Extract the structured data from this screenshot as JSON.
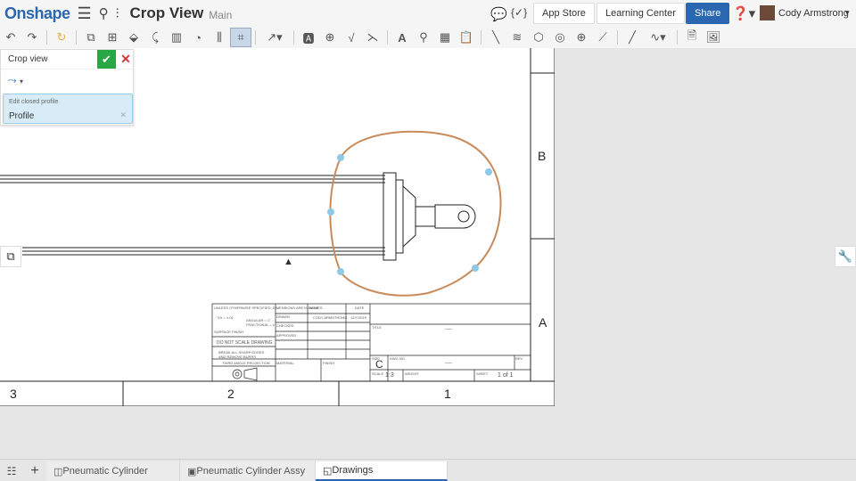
{
  "header": {
    "logo": "Onshape",
    "title": "Crop View",
    "workspace": "Main",
    "app_store": "App Store",
    "learning_center": "Learning Center",
    "share": "Share",
    "user": "Cody Armstrong"
  },
  "toolbar": {
    "icons": [
      "undo-icon",
      "redo-icon",
      "regen-icon",
      "insert-view-icon",
      "projected-view-icon",
      "auxiliary-view-icon",
      "detail-view-icon",
      "section-view-icon",
      "break-view-icon",
      "alignment-icon",
      "crop-view-icon",
      "centerline-icon",
      "note-icon",
      "gdt-icon",
      "surface-finish-icon",
      "weld-icon",
      "text-icon",
      "callout-icon",
      "table-icon",
      "bom-icon",
      "line-icon",
      "hatch-icon",
      "datum-icon",
      "center-mark-icon",
      "bolt-circle-icon",
      "chamfer-icon",
      "sketch-line-icon",
      "spline-icon",
      "export-dxf-icon",
      "image-icon"
    ]
  },
  "crop_panel": {
    "title": "Crop view",
    "field_label": "Edit closed profile",
    "field_value": "Profile"
  },
  "drawing": {
    "zones_bottom": [
      "3",
      "2",
      "1"
    ],
    "zones_right": [
      "B",
      "A"
    ],
    "title_block": {
      "tolerance_note": "UNLESS OTHERWISE SPECIFIED, DIMENSIONS ARE IN INCHES",
      "tol1": ".XX = ±.01",
      ".tol2": "",
      "angular": "ANGULAR = 1°",
      "fractional": "FRACTIONAL = ±",
      "surface_finish": "SURFACE FINISH",
      "no_scale": "DO NOT SCALE DRAWING",
      "break_edges": "BREAK ALL SHARP EDGES AND REMOVE BURRS",
      "projection": "THIRD ANGLE PROJECTION",
      "name": "NAME",
      "date": "DATE",
      "drawn": "DRAWN",
      "drawn_name": "CODY ARMSTRONG",
      "drawn_date": "12/7/2019",
      "checked": "CHECKED",
      "approved": "APPROVED",
      "material": "MATERIAL",
      "finish": "FINISH",
      "title": "TITLE",
      "size_label": "SIZE",
      "size": "C",
      "dwg_no": "DWG NO",
      "rev": "REV",
      "scale_label": "SCALE",
      "scale": "1:3",
      "weight": "WEIGHT",
      "sheet_label": "SHEET",
      "sheet": "1 of 1",
      "placeholder": "----"
    }
  },
  "tabs": [
    {
      "label": "Pneumatic Cylinder"
    },
    {
      "label": "Pneumatic Cylinder Assy"
    },
    {
      "label": "Drawings"
    }
  ],
  "colors": {
    "brand": "#2a67b0",
    "crop_profile": "#c98a5a",
    "handle": "#8ec9e8",
    "confirm": "#28a745"
  }
}
